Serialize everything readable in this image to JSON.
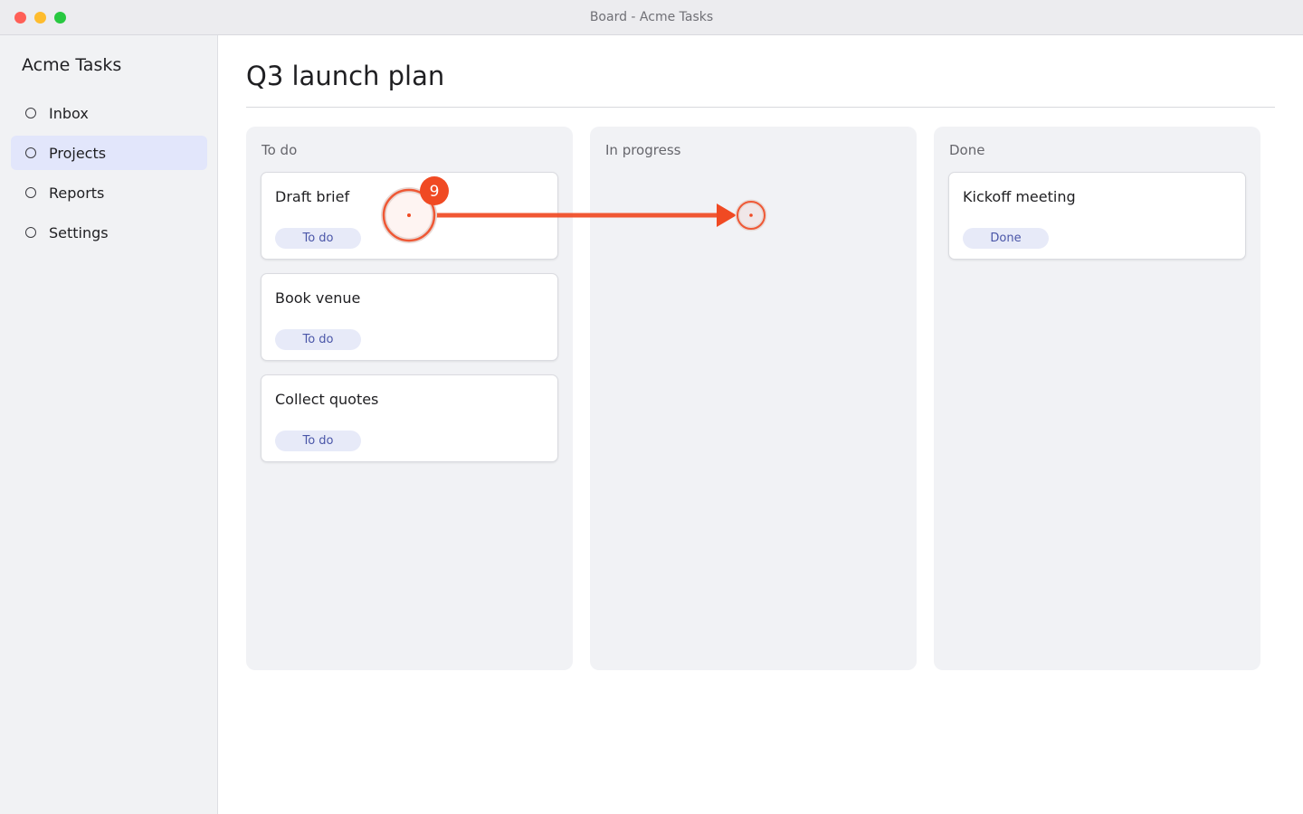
{
  "window": {
    "title": "Board - Acme Tasks"
  },
  "sidebar": {
    "app_name": "Acme Tasks",
    "items": [
      {
        "label": "Inbox",
        "active": false
      },
      {
        "label": "Projects",
        "active": true
      },
      {
        "label": "Reports",
        "active": false
      },
      {
        "label": "Settings",
        "active": false
      }
    ]
  },
  "board": {
    "title": "Q3 launch plan",
    "columns": [
      {
        "title": "To do",
        "cards": [
          {
            "title": "Draft brief",
            "status": "To do"
          },
          {
            "title": "Book venue",
            "status": "To do"
          },
          {
            "title": "Collect quotes",
            "status": "To do"
          }
        ]
      },
      {
        "title": "In progress",
        "cards": []
      },
      {
        "title": "Done",
        "cards": [
          {
            "title": "Kickoff meeting",
            "status": "Done"
          }
        ]
      }
    ]
  },
  "annotation": {
    "step_number": "9",
    "action": "drag",
    "color": "#f04a23"
  }
}
